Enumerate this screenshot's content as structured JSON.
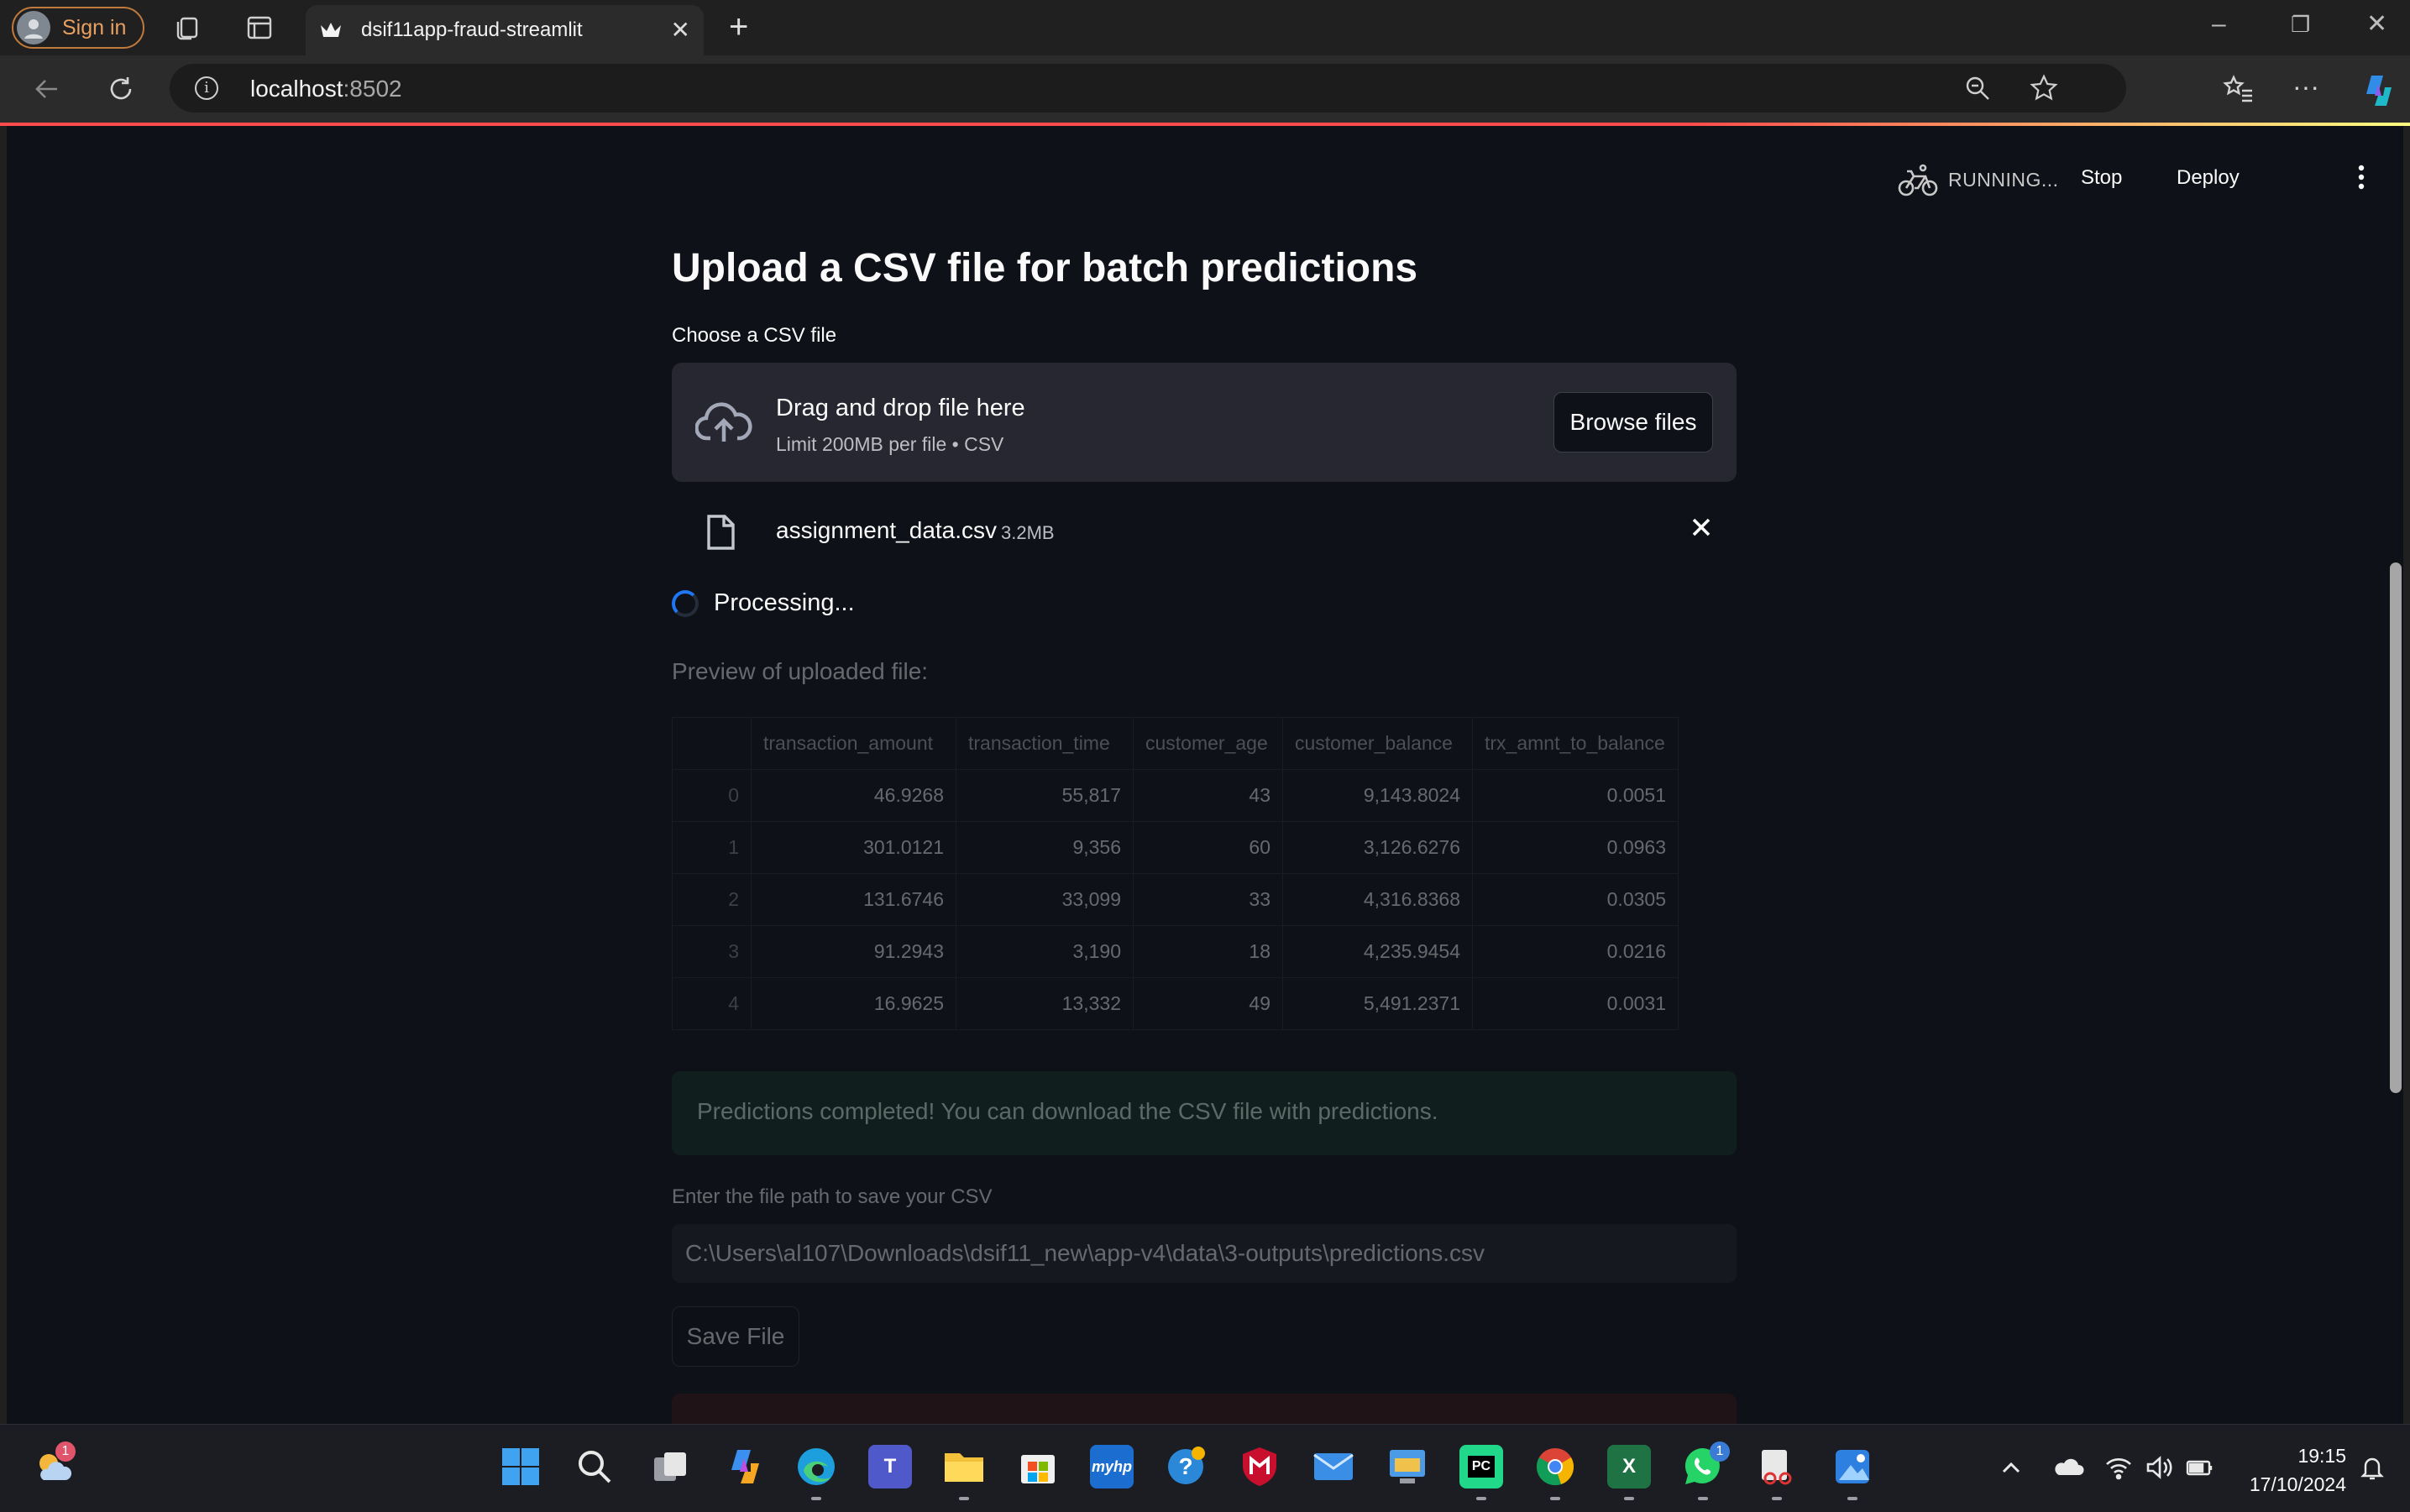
{
  "browser": {
    "signin_label": "Sign in",
    "tab_title": "dsif11app-fraud-streamlit",
    "url_host": "localhost",
    "url_port": ":8502"
  },
  "toolbar": {
    "status": "RUNNING...",
    "stop_label": "Stop",
    "deploy_label": "Deploy"
  },
  "page": {
    "title": "Upload a CSV file for batch predictions",
    "uploader_label": "Choose a CSV file",
    "dropzone_text": "Drag and drop file here",
    "dropzone_limit": "Limit 200MB per file • CSV",
    "browse_label": "Browse files",
    "file_name": "assignment_data.csv",
    "file_size": "3.2MB",
    "spinner_text": "Processing...",
    "preview_heading": "Preview of uploaded file:",
    "success_text": "Predictions completed! You can download the CSV file with predictions.",
    "path_label": "Enter the file path to save your CSV",
    "path_value": "C:\\Users\\al107\\Downloads\\dsif11_new\\app-v4\\data\\3-outputs\\predictions.csv",
    "save_label": "Save File"
  },
  "table": {
    "columns": [
      "",
      "transaction_amount",
      "transaction_time",
      "customer_age",
      "customer_balance",
      "trx_amnt_to_balance"
    ],
    "rows": [
      [
        "0",
        "46.9268",
        "55,817",
        "43",
        "9,143.8024",
        "0.0051"
      ],
      [
        "1",
        "301.0121",
        "9,356",
        "60",
        "3,126.6276",
        "0.0963"
      ],
      [
        "2",
        "131.6746",
        "33,099",
        "33",
        "4,316.8368",
        "0.0305"
      ],
      [
        "3",
        "91.2943",
        "3,190",
        "18",
        "4,235.9454",
        "0.0216"
      ],
      [
        "4",
        "16.9625",
        "13,332",
        "49",
        "5,491.2371",
        "0.0031"
      ]
    ]
  },
  "taskbar": {
    "weather_badge": "1",
    "whatsapp_badge": "1",
    "time": "19:15",
    "date": "17/10/2024"
  },
  "colors": {
    "accent": "#ff4b4b",
    "background": "#0e1117",
    "secondary_bg": "#262730",
    "spinner": "#1f77f5",
    "success_bg": "#173928"
  }
}
